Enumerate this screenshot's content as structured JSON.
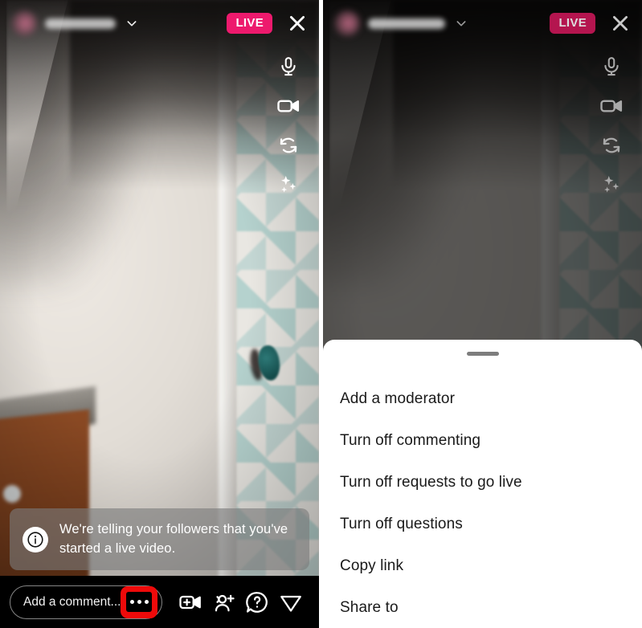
{
  "app": {
    "name": "Instagram Live"
  },
  "colors": {
    "live_badge": "#ED1A6D",
    "highlight_red": "#EE0A0A",
    "sheet_background": "#FFFFFF",
    "bar_background": "#000000",
    "toast_background": "rgba(122,122,122,0.62)"
  },
  "left_panel": {
    "header": {
      "avatar": "blurred-avatar",
      "username": "",
      "username_redacted": true,
      "chevron": "chevron-down-icon",
      "live_label": "LIVE",
      "close_label": "close-icon"
    },
    "rail": [
      {
        "name": "microphone",
        "icon": "microphone-icon",
        "state": "on"
      },
      {
        "name": "camera",
        "icon": "video-camera-icon",
        "state": "on"
      },
      {
        "name": "flip-camera",
        "icon": "camera-flip-icon",
        "state": "on"
      },
      {
        "name": "effects",
        "icon": "sparkles-icon",
        "state": "on"
      }
    ],
    "toast": {
      "icon": "info-circle-icon",
      "text": "We're telling your followers that you've started a live video."
    },
    "bottom_bar": {
      "comment_placeholder": "Add a comment...",
      "more_button": {
        "label": "...",
        "highlighted": true,
        "icon": "more-horizontal-icon"
      },
      "actions": [
        {
          "name": "add-video",
          "icon": "add-video-icon"
        },
        {
          "name": "add-person",
          "icon": "add-person-icon"
        },
        {
          "name": "questions",
          "icon": "question-bubble-icon"
        },
        {
          "name": "share",
          "icon": "send-paper-plane-icon"
        }
      ]
    }
  },
  "right_panel": {
    "dimmed": true,
    "header": {
      "avatar": "blurred-avatar",
      "username": "",
      "username_redacted": true,
      "chevron": "chevron-down-icon",
      "live_label": "LIVE",
      "close_label": "close-icon"
    },
    "rail": [
      {
        "name": "microphone",
        "icon": "microphone-icon",
        "state": "on"
      },
      {
        "name": "camera",
        "icon": "video-camera-icon",
        "state": "on"
      },
      {
        "name": "flip-camera",
        "icon": "camera-flip-icon",
        "state": "on"
      },
      {
        "name": "effects",
        "icon": "sparkles-icon",
        "state": "on"
      }
    ],
    "sheet": {
      "handle": "drag-handle",
      "items": [
        {
          "label": "Add a moderator"
        },
        {
          "label": "Turn off commenting"
        },
        {
          "label": "Turn off requests to go live"
        },
        {
          "label": "Turn off questions"
        },
        {
          "label": "Copy link"
        },
        {
          "label": "Share to"
        }
      ]
    }
  }
}
